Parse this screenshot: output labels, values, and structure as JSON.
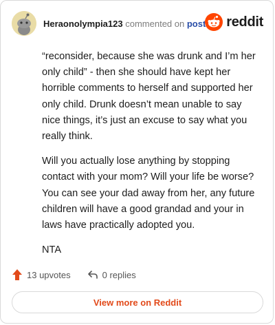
{
  "comment": {
    "username": "Heraonolympia123",
    "action_text": "commented on",
    "post_link": "post",
    "paragraphs": [
      "“reconsider, because she was drunk and I’m her only child” - then she should have kept her horrible comments to herself and supported her only child. Drunk doesn’t mean unable to say nice things, it’s just an excuse to say what you really think.",
      "Will you actually lose anything by stopping contact with your mom? Will your life be worse? You can see your dad away from her, any future children will have a good grandad and your in laws have practically adopted you.",
      "NTA"
    ]
  },
  "brand": {
    "name": "reddit",
    "color": "#ff4500"
  },
  "footer": {
    "upvotes": "13 upvotes",
    "replies": "0 replies",
    "upvote_color": "#e24a1a"
  },
  "cta": {
    "label": "View more on Reddit",
    "color": "#e24a1a"
  },
  "icons": [
    "snoo-avatar-icon",
    "reddit-logo-icon",
    "upvote-arrow-icon",
    "reply-arrow-icon"
  ]
}
